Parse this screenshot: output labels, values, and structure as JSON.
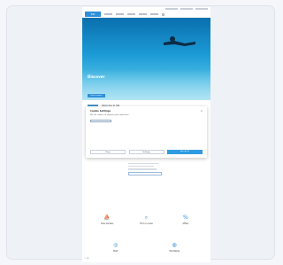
{
  "site": {
    "logo": "SSI"
  },
  "hero": {
    "title": "Discover",
    "button": "Find a center"
  },
  "intro": {
    "title": "Welcome to SSI"
  },
  "consent": {
    "title": "Cookie Settings",
    "text": "We use cookies to improve your experience.",
    "buttons": [
      "Deny",
      "Settings",
      "Accept all"
    ],
    "close": "×"
  },
  "features": [
    {
      "icon": "boat-icon",
      "label": "Dive Centers"
    },
    {
      "icon": "search-icon",
      "label": "Find a course"
    },
    {
      "icon": "percent-icon",
      "label": "Offers"
    },
    {
      "icon": "diver-icon",
      "label": "Start"
    },
    {
      "icon": "globe-icon",
      "label": "Worldwide"
    }
  ],
  "footer": "© SSI"
}
